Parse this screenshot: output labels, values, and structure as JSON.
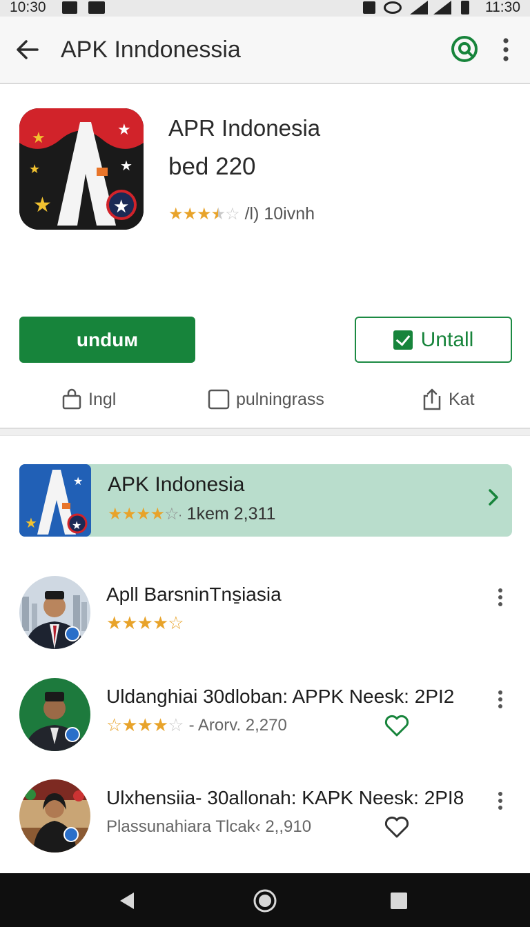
{
  "status_bar": {
    "time_left": "10:30",
    "time_right": "11:30"
  },
  "app_bar": {
    "title": "APK Inndonessia"
  },
  "app": {
    "name": "APR Indonesia",
    "subtitle": "bed 220",
    "rating_stars": 3.5,
    "rating_text": "/l) 10ivnh",
    "primary_button": "unduм",
    "secondary_button": "Untall",
    "actions": [
      {
        "label": "Ingl",
        "icon": "bag-icon"
      },
      {
        "label": "pulningrass",
        "icon": "checkbox-icon"
      },
      {
        "label": "Kat",
        "icon": "share-icon"
      }
    ]
  },
  "featured": {
    "title": "APK Indonesia",
    "rating_stars": 4.5,
    "rating_text": "1kem 2,311"
  },
  "list": [
    {
      "title": "Apll BarsninTns̱iasia",
      "rating_stars": 4.5,
      "sub_text": ""
    },
    {
      "title": "Uldanghiai 30dloban: APPK Neesk: 2PI2",
      "rating_stars": 4,
      "sub_text": "- Arorv. 2,270",
      "heart": true
    },
    {
      "title": "Ulxhensiia- 30allonah: KAPK Neesk: 2PI8",
      "rating_stars": null,
      "sub_text": "Plassunahiara Tlcak‹ 2,,910",
      "heart": true
    }
  ],
  "colors": {
    "accent": "#17843b",
    "star": "#e8a32a",
    "featured_bg": "#b9ddcc"
  }
}
